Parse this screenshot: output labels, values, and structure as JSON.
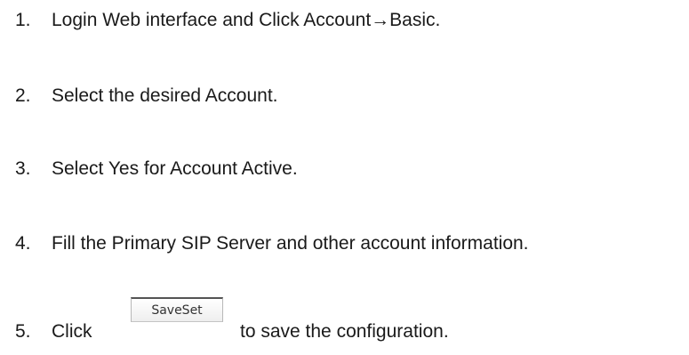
{
  "steps": [
    {
      "number": "1.",
      "text": "Login Web interface and Click Account→Basic."
    },
    {
      "number": "2.",
      "text": "Select the desired Account."
    },
    {
      "number": "3.",
      "text": "Select Yes for Account Active."
    },
    {
      "number": "4.",
      "text": "Fill the Primary SIP Server and other account information."
    },
    {
      "number": "5.",
      "text": "Click"
    }
  ],
  "save_button": {
    "label": "SaveSet"
  },
  "step5_suffix": "to save the configuration."
}
